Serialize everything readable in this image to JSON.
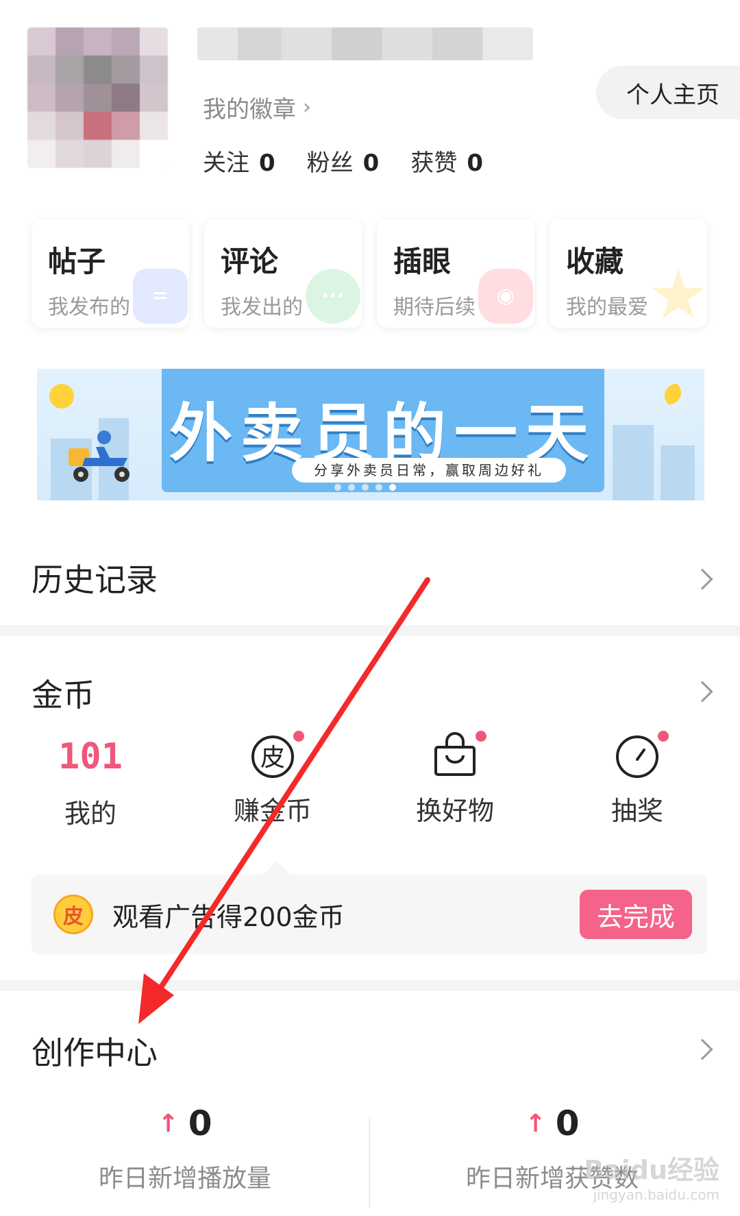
{
  "profile": {
    "badge_link": "我的徽章",
    "homepage_button": "个人主页",
    "stats": [
      {
        "label": "关注",
        "value": "0"
      },
      {
        "label": "粉丝",
        "value": "0"
      },
      {
        "label": "获赞",
        "value": "0"
      }
    ]
  },
  "cards": [
    {
      "title": "帖子",
      "sub": "我发布的",
      "icon": "post-icon",
      "color": "#c9d7ff"
    },
    {
      "title": "评论",
      "sub": "我发出的",
      "icon": "comment-icon",
      "color": "#bfeecb"
    },
    {
      "title": "插眼",
      "sub": "期待后续",
      "icon": "eye-icon",
      "color": "#ffc2c8"
    },
    {
      "title": "收藏",
      "sub": "我的最爱",
      "icon": "star-icon",
      "color": "#ffeaa6"
    }
  ],
  "banner": {
    "headline": "外卖员的一天",
    "tagline": "分享外卖员日常，赢取周边好礼",
    "page_count": 5,
    "active_page": 5
  },
  "history": {
    "title": "历史记录"
  },
  "coins": {
    "title": "金币",
    "balance": "101",
    "items": [
      {
        "label": "我的",
        "icon": null
      },
      {
        "label": "赚金币",
        "icon": "pi-coin-icon",
        "glyph": "皮"
      },
      {
        "label": "换好物",
        "icon": "shopping-bag-icon"
      },
      {
        "label": "抽奖",
        "icon": "dial-icon"
      }
    ],
    "task": {
      "icon_glyph": "皮",
      "text": "观看广告得200金币",
      "button": "去完成"
    }
  },
  "creator": {
    "title": "创作中心",
    "stats": [
      {
        "value": "0",
        "label": "昨日新增播放量"
      },
      {
        "value": "0",
        "label": "昨日新增获赞数"
      }
    ]
  },
  "colors": {
    "accent": "#f0577a",
    "button": "#f5638a",
    "banner": "#6cb8f2",
    "annotation_arrow": "#f42a2a"
  },
  "watermark": {
    "brand": "Baidu经验",
    "url": "jingyan.baidu.com"
  }
}
